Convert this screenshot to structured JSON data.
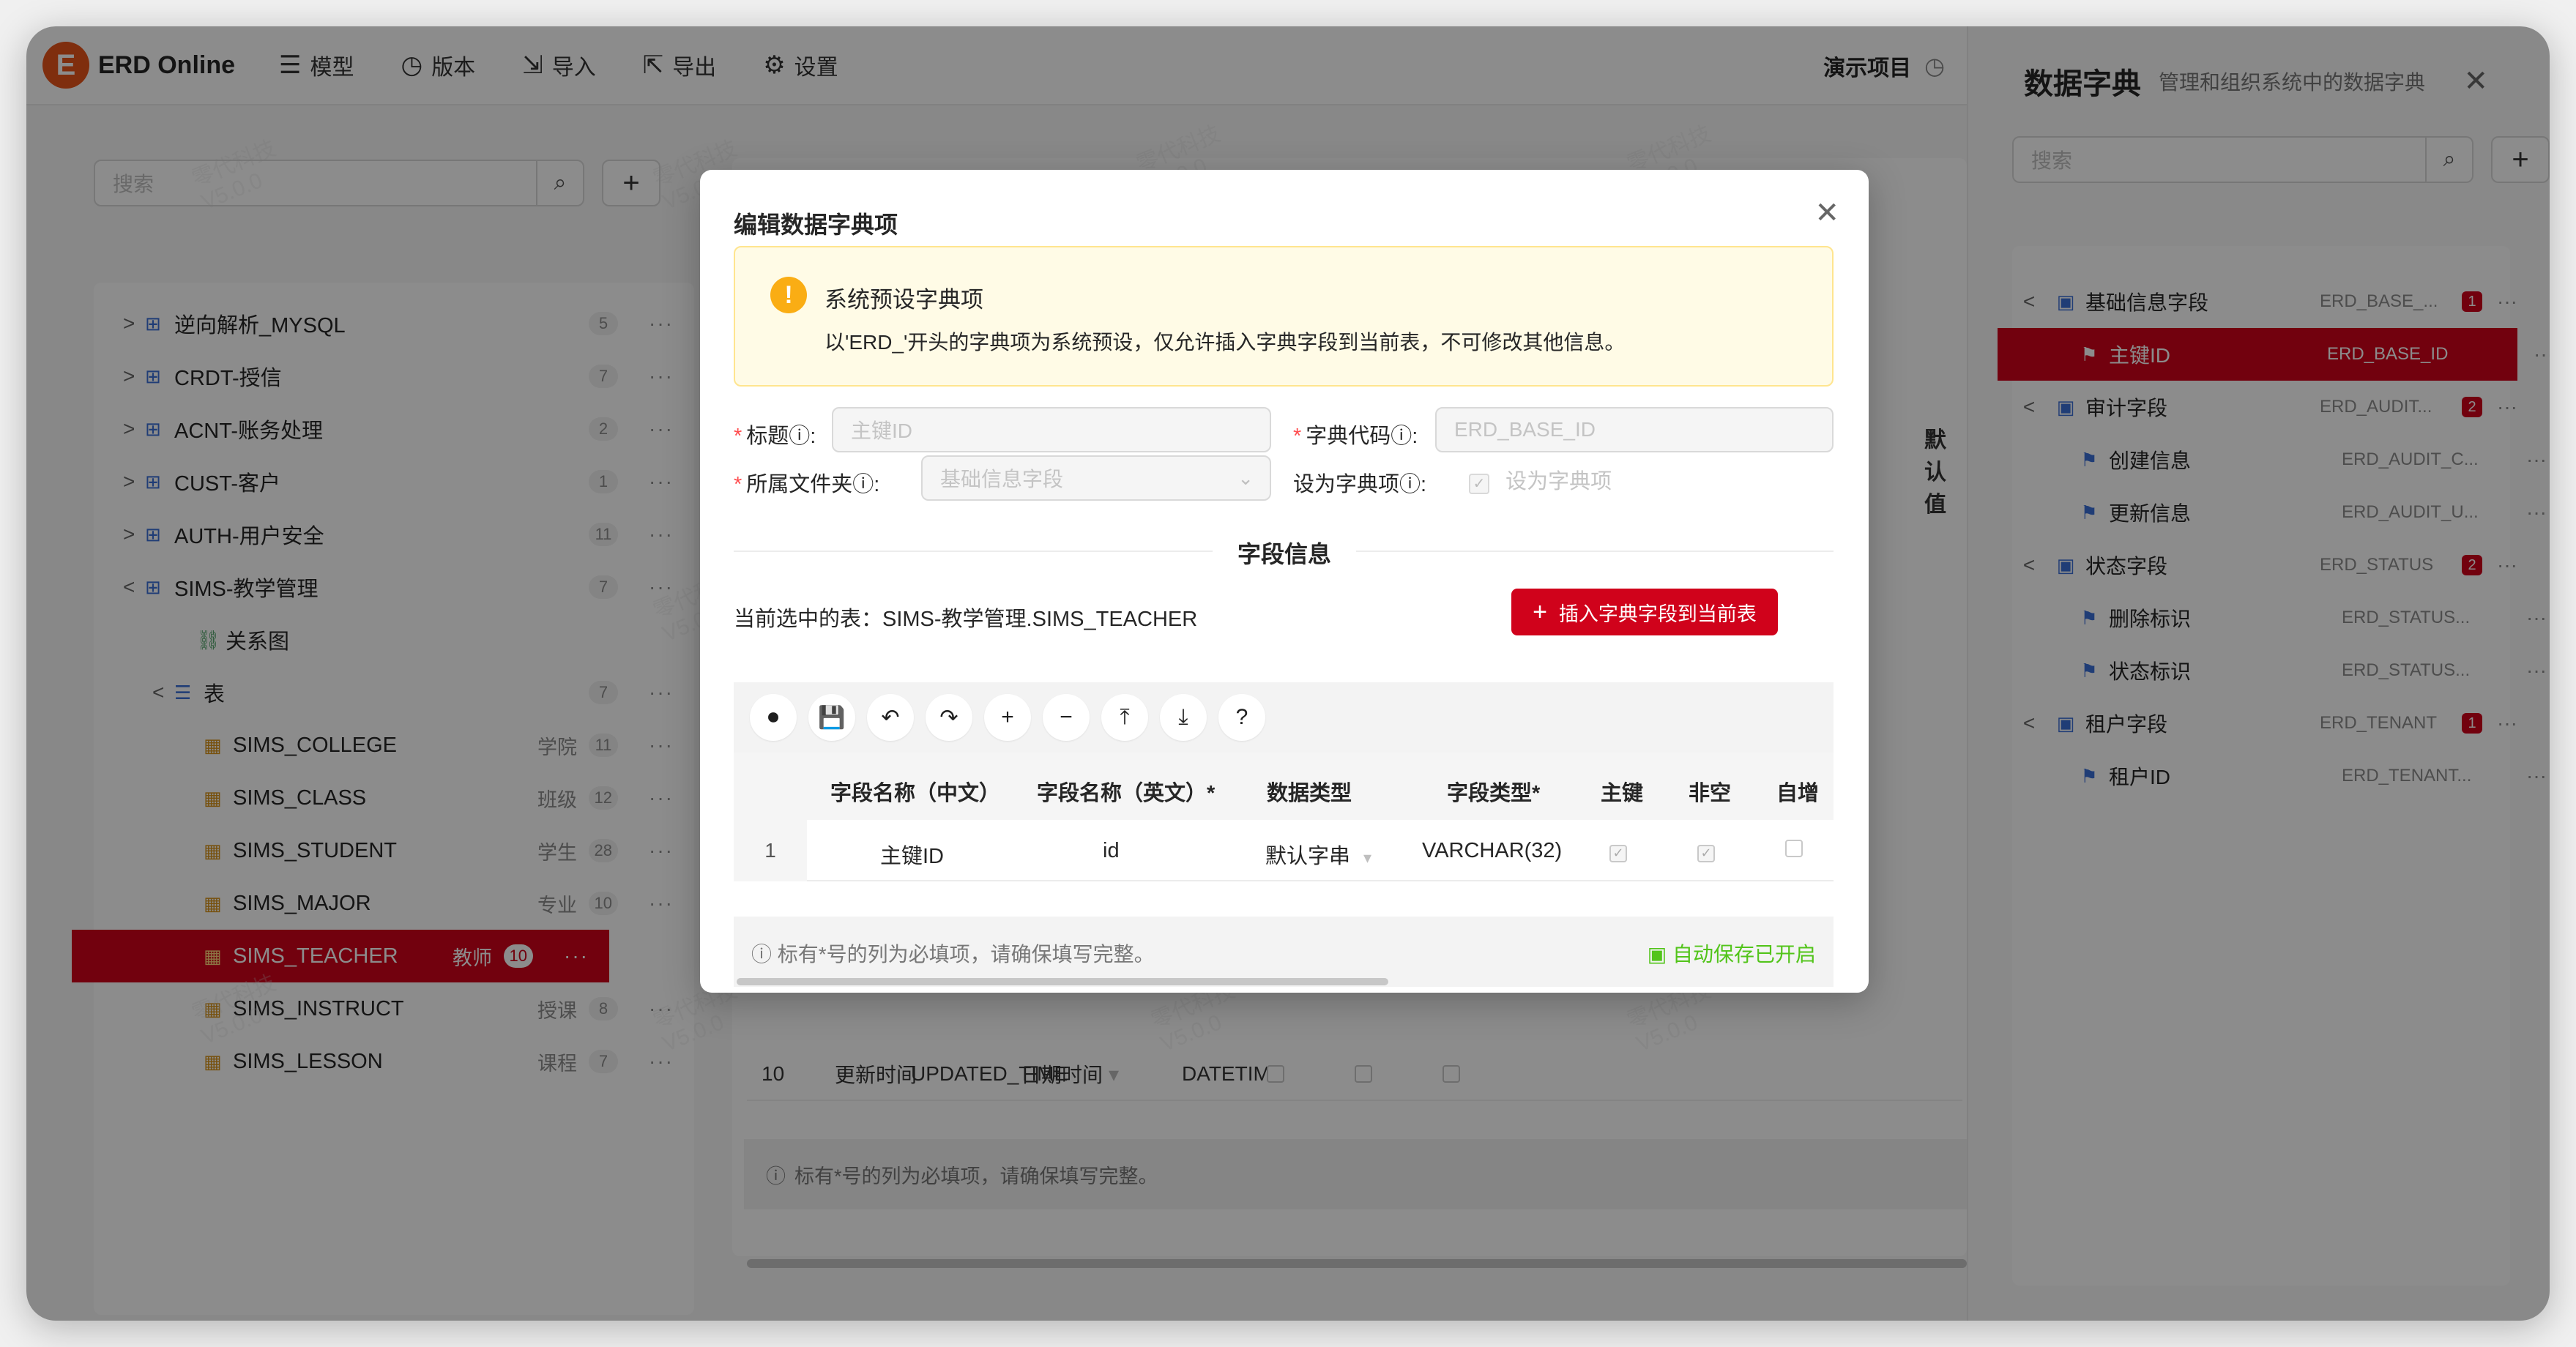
{
  "app": {
    "logo_letter": "E",
    "name": "ERD Online",
    "nav": [
      {
        "icon": "☰",
        "label": "模型"
      },
      {
        "icon": "◷",
        "label": "版本"
      },
      {
        "icon": "⇲",
        "label": "导入"
      },
      {
        "icon": "⇱",
        "label": "导出"
      },
      {
        "icon": "⚙",
        "label": "设置"
      }
    ],
    "project_name": "演示项目"
  },
  "left_panel": {
    "search_placeholder": "搜索",
    "tree": [
      {
        "arrow": ">",
        "label": "逆向解析_MYSQL",
        "cn": "",
        "count": "5"
      },
      {
        "arrow": ">",
        "label": "CRDT-授信",
        "cn": "",
        "count": "7"
      },
      {
        "arrow": ">",
        "label": "ACNT-账务处理",
        "cn": "",
        "count": "2"
      },
      {
        "arrow": ">",
        "label": "CUST-客户",
        "cn": "",
        "count": "1"
      },
      {
        "arrow": ">",
        "label": "AUTH-用户安全",
        "cn": "",
        "count": "11"
      },
      {
        "arrow": "<",
        "label": "SIMS-教学管理",
        "cn": "",
        "count": "7"
      },
      {
        "arrow": "",
        "label": "关系图",
        "cn": "",
        "count": ""
      },
      {
        "arrow": "<",
        "label": "表",
        "cn": "",
        "count": "7"
      },
      {
        "arrow": "",
        "label": "SIMS_COLLEGE",
        "cn": "学院",
        "count": "11"
      },
      {
        "arrow": "",
        "label": "SIMS_CLASS",
        "cn": "班级",
        "count": "12"
      },
      {
        "arrow": "",
        "label": "SIMS_STUDENT",
        "cn": "学生",
        "count": "28"
      },
      {
        "arrow": "",
        "label": "SIMS_MAJOR",
        "cn": "专业",
        "count": "10"
      },
      {
        "arrow": "",
        "label": "SIMS_TEACHER",
        "cn": "教师",
        "count": "10"
      },
      {
        "arrow": "",
        "label": "SIMS_INSTRUCT",
        "cn": "授课",
        "count": "8"
      },
      {
        "arrow": "",
        "label": "SIMS_LESSON",
        "cn": "课程",
        "count": "7"
      }
    ]
  },
  "background_table": {
    "col_header_default": "默认值",
    "row10": {
      "idx": "10",
      "cn": "更新时间",
      "en": "UPDATED_TIME",
      "dtype": "日期时间",
      "ftype": "DATETIME"
    },
    "footer_note": "标有*号的列为必填项，请确保填写完整。"
  },
  "right_panel": {
    "title": "数据字典",
    "subtitle": "管理和组织系统中的数据字典",
    "search_placeholder": "搜索",
    "items": [
      {
        "kind": "group",
        "label": "基础信息字段",
        "code": "ERD_BASE_...",
        "badge": "1"
      },
      {
        "kind": "child",
        "label": "主键ID",
        "code": "ERD_BASE_ID"
      },
      {
        "kind": "group",
        "label": "审计字段",
        "code": "ERD_AUDIT...",
        "badge": "2"
      },
      {
        "kind": "child",
        "label": "创建信息",
        "code": "ERD_AUDIT_C..."
      },
      {
        "kind": "child",
        "label": "更新信息",
        "code": "ERD_AUDIT_U..."
      },
      {
        "kind": "group",
        "label": "状态字段",
        "code": "ERD_STATUS",
        "badge": "2"
      },
      {
        "kind": "child",
        "label": "删除标识",
        "code": "ERD_STATUS..."
      },
      {
        "kind": "child",
        "label": "状态标识",
        "code": "ERD_STATUS..."
      },
      {
        "kind": "group",
        "label": "租户字段",
        "code": "ERD_TENANT",
        "badge": "1"
      },
      {
        "kind": "child",
        "label": "租户ID",
        "code": "ERD_TENANT..."
      }
    ]
  },
  "watermark": {
    "line1": "零代科技",
    "line2": "V5.0.0"
  },
  "modal": {
    "title": "编辑数据字典项",
    "alert_title": "系统预设字典项",
    "alert_desc": "以'ERD_'开头的字典项为系统预设，仅允许插入字典字段到当前表，不可修改其他信息。",
    "label_title": "标题ⓘ:",
    "title_value": "主键ID",
    "label_code": "字典代码ⓘ:",
    "code_value": "ERD_BASE_ID",
    "label_folder": "所属文件夹ⓘ:",
    "folder_value": "基础信息字段",
    "label_set_dict": "设为字典项ⓘ:",
    "set_dict_text": "设为字典项",
    "section_title": "字段信息",
    "current_table": "当前选中的表：SIMS-教学管理.SIMS_TEACHER",
    "insert_button": "插入字典字段到当前表",
    "columns": [
      "字段名称（中文）",
      "字段名称（英文）*",
      "数据类型",
      "字段类型*",
      "主键",
      "非空",
      "自增"
    ],
    "row": {
      "idx": "1",
      "cn": "主键ID",
      "en": "id",
      "dtype": "默认字串",
      "ftype": "VARCHAR(32)"
    },
    "footer_note": "标有*号的列为必填项，请确保填写完整。",
    "autosave": "自动保存已开启"
  }
}
